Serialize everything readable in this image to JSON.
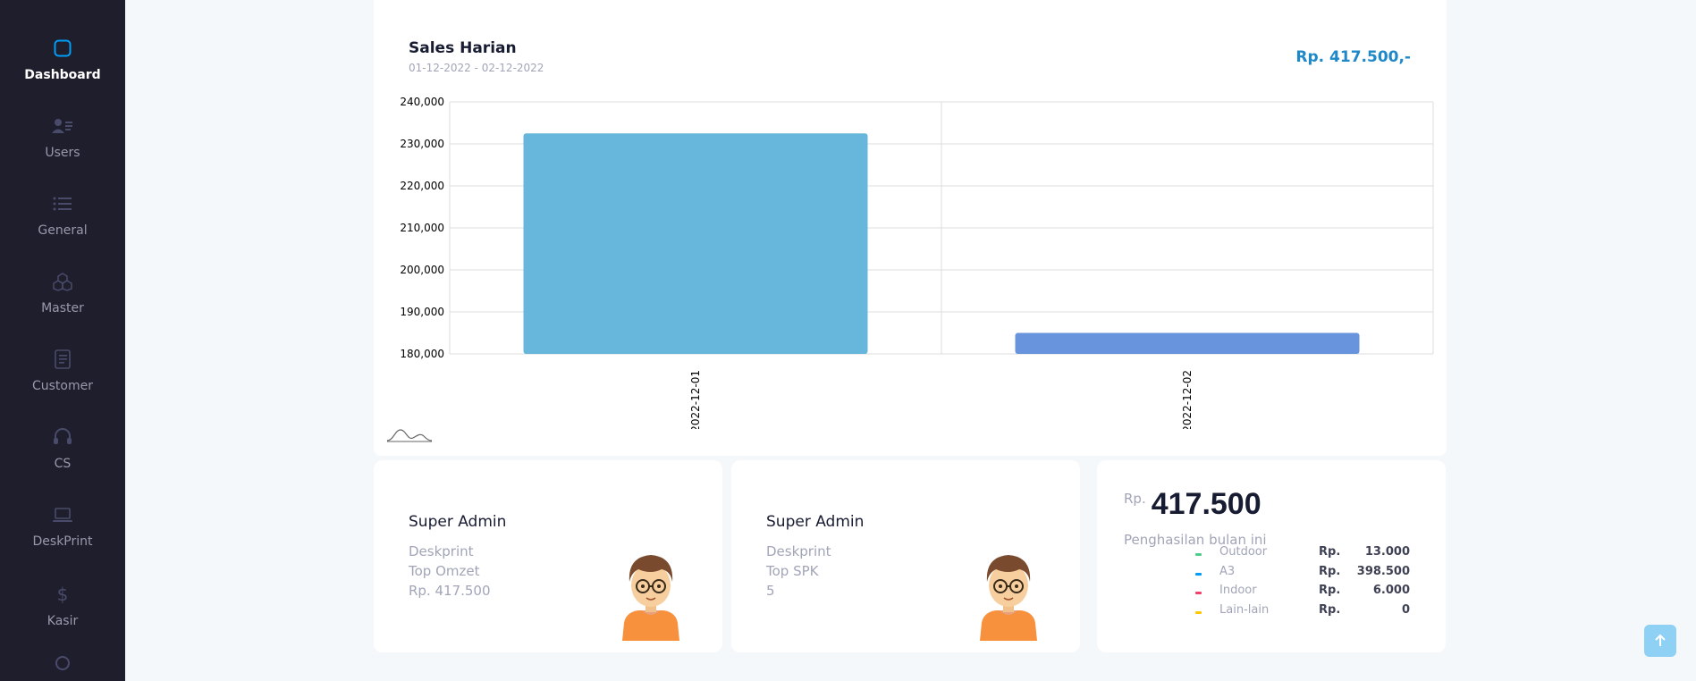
{
  "sidebar": {
    "items": [
      {
        "label": "Dashboard",
        "icon": "square-icon",
        "active": true
      },
      {
        "label": "Users",
        "icon": "users-icon"
      },
      {
        "label": "General",
        "icon": "list-icon"
      },
      {
        "label": "Master",
        "icon": "cubes-icon"
      },
      {
        "label": "Customer",
        "icon": "notebook-icon"
      },
      {
        "label": "CS",
        "icon": "headset-icon"
      },
      {
        "label": "DeskPrint",
        "icon": "laptop-icon"
      },
      {
        "label": "Kasir",
        "icon": "dollar-icon"
      }
    ]
  },
  "sales_chart": {
    "title": "Sales Harian",
    "date_range": "01-12-2022 - 02-12-2022",
    "total": "Rp. 417.500,-"
  },
  "chart_data": {
    "type": "bar",
    "categories": [
      "2022-12-01",
      "2022-12-02"
    ],
    "values": [
      232500,
      185000
    ],
    "ylim": [
      180000,
      240000
    ],
    "yticks": [
      "180,000",
      "190,000",
      "200,000",
      "210,000",
      "220,000",
      "230,000",
      "240,000"
    ],
    "colors": [
      "#67b7dc",
      "#6794dc"
    ],
    "grid": true
  },
  "card_omzet": {
    "title": "Super Admin",
    "line1": "Deskprint",
    "line2": "Top Omzet",
    "line3": "Rp. 417.500"
  },
  "card_spk": {
    "title": "Super Admin",
    "line1": "Deskprint",
    "line2": "Top SPK",
    "line3": "5"
  },
  "income": {
    "currency": "Rp.",
    "amount": "417.500",
    "subtitle": "Penghasilan bulan ini",
    "rows": [
      {
        "name": "Outdoor",
        "rp": "Rp.",
        "value": "13.000",
        "color": "#50cd89"
      },
      {
        "name": "A3",
        "rp": "Rp.",
        "value": "398.500",
        "color": "#009ef7"
      },
      {
        "name": "Indoor",
        "rp": "Rp.",
        "value": "6.000",
        "color": "#f1416c"
      },
      {
        "name": "Lain-lain",
        "rp": "Rp.",
        "value": "0",
        "color": "#ffc700"
      }
    ]
  }
}
